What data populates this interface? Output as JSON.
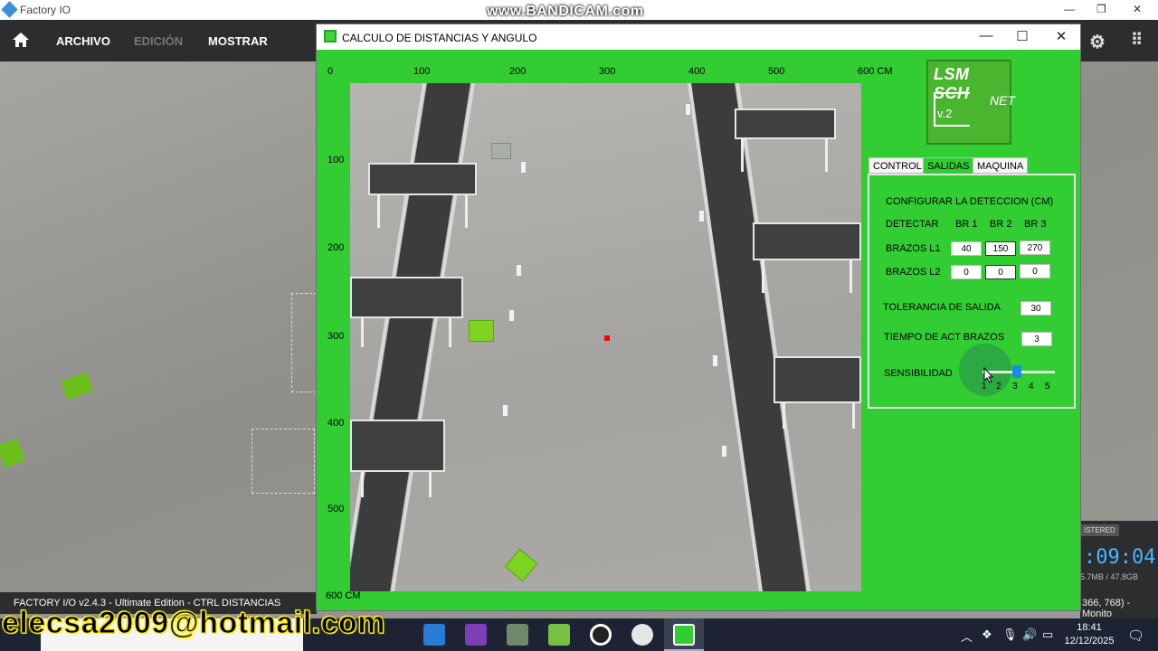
{
  "factoryio": {
    "app_title": "Factory IO",
    "watermark": "www.BANDICAM.com",
    "menu": {
      "archivo": "ARCHIVO",
      "edicion": "EDICIÓN",
      "mostrar": "MOSTRAR"
    },
    "status_text": "FACTORY I/O v2.4.3 - Ultimate Edition - CTRL DISTANCIAS",
    "registered": "ISTERED",
    "clock": ":09:04",
    "memory": "5.7MB / 47.8GB",
    "resolution": "366, 768) - Monito"
  },
  "window": {
    "title": "CALCULO DE DISTANCIAS Y ANGULO",
    "x_ticks": [
      "0",
      "100",
      "200",
      "300",
      "400",
      "500",
      "600 CM"
    ],
    "y_ticks": [
      "100",
      "200",
      "300",
      "400",
      "500",
      "600 CM"
    ],
    "logo": {
      "line1": "LSM SCH",
      "version": "v.2",
      "net": "NET"
    },
    "tabs": [
      "CONTROL",
      "SALIDAS",
      "MAQUINA"
    ],
    "active_tab": "SALIDAS",
    "salidas": {
      "heading": "CONFIGURAR LA DETECCION (CM)",
      "detectar": "DETECTAR",
      "col_headers": [
        "BR 1",
        "BR 2",
        "BR 3"
      ],
      "row_l1_label": "BRAZOS L1",
      "row_l1_values": [
        "40",
        "150",
        "270"
      ],
      "row_l2_label": "BRAZOS L2",
      "row_l2_values": [
        "0",
        "0",
        "0"
      ],
      "tolerancia_label": "TOLERANCIA DE SALIDA",
      "tolerancia_value": "30",
      "tiempo_label": "TIEMPO DE ACT BRAZOS",
      "tiempo_value": "3",
      "sensibilidad_label": "SENSIBILIDAD",
      "sensibilidad_ticks": [
        "1",
        "2",
        "3",
        "4",
        "5"
      ],
      "sensibilidad_value": 3
    }
  },
  "taskbar": {
    "time": "18:41",
    "date": "12/12/2025"
  },
  "overlay_email": "elecsa2009@hotmail.com",
  "colors": {
    "window_bg": "#32cd32",
    "slider_thumb": "#1e88e5",
    "box": "#7ed321"
  }
}
